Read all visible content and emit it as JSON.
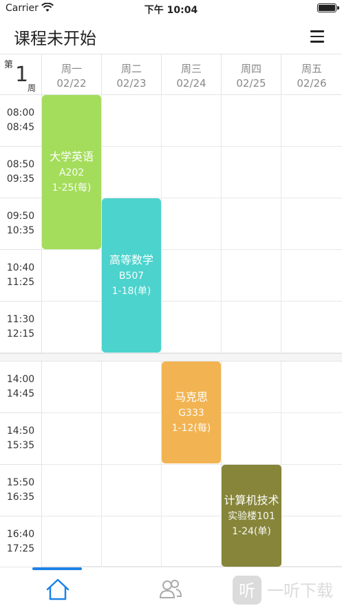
{
  "status": {
    "carrier": "Carrier",
    "time": "下午 10:04"
  },
  "nav": {
    "title": "课程未开始"
  },
  "week": {
    "prefix": "第",
    "number": "1",
    "suffix": "周"
  },
  "days": [
    {
      "name": "周一",
      "date": "02/22"
    },
    {
      "name": "周二",
      "date": "02/23"
    },
    {
      "name": "周三",
      "date": "02/24"
    },
    {
      "name": "周四",
      "date": "02/25"
    },
    {
      "name": "周五",
      "date": "02/26"
    }
  ],
  "morning_slots": [
    {
      "start": "08:00",
      "end": "08:45"
    },
    {
      "start": "08:50",
      "end": "09:35"
    },
    {
      "start": "09:50",
      "end": "10:35"
    },
    {
      "start": "10:40",
      "end": "11:25"
    },
    {
      "start": "11:30",
      "end": "12:15"
    }
  ],
  "afternoon_slots": [
    {
      "start": "14:00",
      "end": "14:45"
    },
    {
      "start": "14:50",
      "end": "15:35"
    },
    {
      "start": "15:50",
      "end": "16:35"
    },
    {
      "start": "16:40",
      "end": "17:25"
    }
  ],
  "courses": [
    {
      "name": "大学英语",
      "room": "A202",
      "weeks": "1-25(每)",
      "color": "#a4dd5c"
    },
    {
      "name": "高等数学",
      "room": "B507",
      "weeks": "1-18(单)",
      "color": "#4cd3cd"
    },
    {
      "name": "马克思",
      "room": "G333",
      "weeks": "1-12(每)",
      "color": "#f2b452"
    },
    {
      "name": "计算机技术",
      "room": "实验楼101",
      "weeks": "1-24(单)",
      "color": "#86853a"
    }
  ],
  "tabs": [
    {
      "icon": "home-icon",
      "active": true
    },
    {
      "icon": "people-icon",
      "active": false
    }
  ],
  "accent": "#1c82e6"
}
